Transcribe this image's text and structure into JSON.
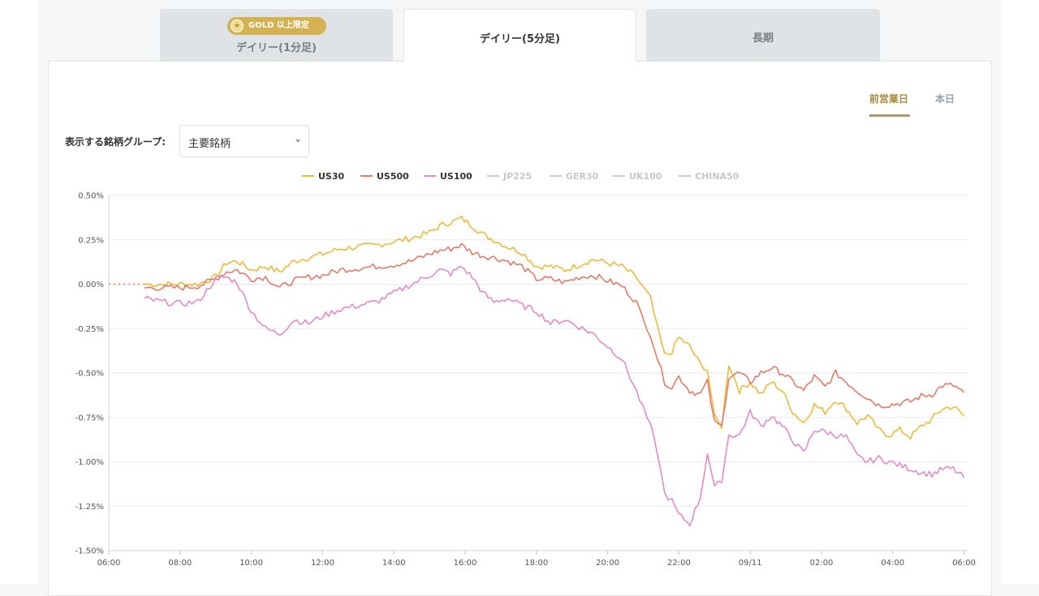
{
  "tabs": [
    {
      "label": "デイリー(1分足)",
      "badge": "GOLD 以上限定",
      "active": false
    },
    {
      "label": "デイリー(5分足)",
      "active": true
    },
    {
      "label": "長期",
      "active": false
    }
  ],
  "period_toggle": {
    "previous_day": "前営業日",
    "today": "本日",
    "selected": "前営業日"
  },
  "group_filter": {
    "label": "表示する銘柄グループ:",
    "value": "主要銘柄"
  },
  "colors": {
    "accent_gold": "#d4b251",
    "US30": "#f0b93a",
    "US500": "#e57a67",
    "US100": "#e48ac8",
    "inactive": "#c9ccd0"
  },
  "chart_data": {
    "type": "line",
    "y_unit": "%",
    "ylim": [
      -1.5,
      0.5
    ],
    "y_ticks": [
      "0.50%",
      "0.25%",
      "0.00%",
      "-0.25%",
      "-0.50%",
      "-0.75%",
      "-1.00%",
      "-1.25%",
      "-1.50%"
    ],
    "x_range_hours": [
      6,
      30.1
    ],
    "x_ticks": [
      "06:00",
      "08:00",
      "10:00",
      "12:00",
      "14:00",
      "16:00",
      "18:00",
      "20:00",
      "22:00",
      "09/11",
      "02:00",
      "04:00",
      "06:00"
    ],
    "legend_position": "top-center",
    "grid": true,
    "pre_open_dotted": {
      "x": [
        6,
        7
      ],
      "y": [
        0,
        0
      ]
    },
    "series": [
      {
        "name": "US30",
        "active": true,
        "x": [
          7,
          7.5,
          8,
          8.5,
          9,
          9.3,
          9.6,
          10,
          10.4,
          10.8,
          11.2,
          11.6,
          12,
          12.5,
          13,
          13.5,
          14,
          14.5,
          15,
          15.3,
          15.6,
          15.9,
          16.2,
          16.5,
          16.8,
          17.2,
          17.6,
          18,
          18.4,
          18.8,
          19.2,
          19.6,
          20,
          20.4,
          20.8,
          21,
          21.2,
          21.4,
          21.6,
          21.8,
          22,
          22.3,
          22.6,
          22.8,
          23,
          23.2,
          23.4,
          23.7,
          24,
          24.3,
          24.6,
          24.9,
          25.2,
          25.5,
          25.8,
          26.1,
          26.4,
          26.7,
          27,
          27.3,
          27.6,
          27.9,
          28.2,
          28.5,
          28.8,
          29.1,
          29.4,
          29.7,
          30
        ],
        "y": [
          0,
          0,
          0,
          0,
          0.04,
          0.12,
          0.13,
          0.08,
          0.1,
          0.07,
          0.13,
          0.15,
          0.17,
          0.2,
          0.21,
          0.22,
          0.24,
          0.26,
          0.29,
          0.33,
          0.35,
          0.37,
          0.33,
          0.28,
          0.25,
          0.21,
          0.18,
          0.1,
          0.1,
          0.08,
          0.11,
          0.14,
          0.12,
          0.1,
          0.04,
          -0.02,
          -0.08,
          -0.25,
          -0.4,
          -0.38,
          -0.3,
          -0.35,
          -0.45,
          -0.48,
          -0.75,
          -0.8,
          -0.45,
          -0.6,
          -0.55,
          -0.62,
          -0.55,
          -0.6,
          -0.72,
          -0.78,
          -0.68,
          -0.72,
          -0.65,
          -0.7,
          -0.78,
          -0.74,
          -0.82,
          -0.85,
          -0.82,
          -0.86,
          -0.8,
          -0.76,
          -0.7,
          -0.69,
          -0.74
        ]
      },
      {
        "name": "US500",
        "active": true,
        "x": [
          7,
          7.5,
          8,
          8.5,
          9,
          9.3,
          9.6,
          10,
          10.4,
          10.8,
          11.2,
          11.6,
          12,
          12.5,
          13,
          13.5,
          14,
          14.5,
          15,
          15.3,
          15.6,
          15.9,
          16.2,
          16.5,
          16.8,
          17.2,
          17.6,
          18,
          18.4,
          18.8,
          19.2,
          19.6,
          20,
          20.4,
          20.8,
          21,
          21.2,
          21.4,
          21.6,
          21.8,
          22,
          22.3,
          22.6,
          22.8,
          23,
          23.2,
          23.4,
          23.7,
          24,
          24.3,
          24.6,
          24.9,
          25.2,
          25.5,
          25.8,
          26.1,
          26.4,
          26.7,
          27,
          27.3,
          27.6,
          27.9,
          28.2,
          28.5,
          28.8,
          29.1,
          29.4,
          29.7,
          30
        ],
        "y": [
          -0.02,
          -0.02,
          -0.02,
          -0.01,
          0.03,
          0.07,
          0.08,
          0.03,
          0.04,
          -0.02,
          0.02,
          0.04,
          0.05,
          0.08,
          0.09,
          0.1,
          0.11,
          0.13,
          0.17,
          0.19,
          0.2,
          0.22,
          0.18,
          0.16,
          0.15,
          0.13,
          0.1,
          0.03,
          0.03,
          0.01,
          0.04,
          0.05,
          0.02,
          -0.01,
          -0.1,
          -0.2,
          -0.28,
          -0.42,
          -0.55,
          -0.58,
          -0.52,
          -0.6,
          -0.62,
          -0.55,
          -0.78,
          -0.8,
          -0.52,
          -0.5,
          -0.55,
          -0.5,
          -0.47,
          -0.5,
          -0.55,
          -0.6,
          -0.52,
          -0.58,
          -0.5,
          -0.55,
          -0.6,
          -0.64,
          -0.68,
          -0.68,
          -0.67,
          -0.66,
          -0.63,
          -0.62,
          -0.57,
          -0.57,
          -0.61
        ]
      },
      {
        "name": "US100",
        "active": true,
        "x": [
          7,
          7.5,
          8,
          8.5,
          9,
          9.3,
          9.6,
          10,
          10.4,
          10.8,
          11.2,
          11.6,
          12,
          12.5,
          13,
          13.5,
          14,
          14.5,
          15,
          15.3,
          15.6,
          15.9,
          16.2,
          16.5,
          16.8,
          17.2,
          17.6,
          18,
          18.4,
          18.8,
          19.2,
          19.6,
          20,
          20.4,
          20.8,
          21,
          21.2,
          21.4,
          21.6,
          21.8,
          22,
          22.3,
          22.6,
          22.8,
          23,
          23.2,
          23.4,
          23.7,
          24,
          24.3,
          24.6,
          24.9,
          25.2,
          25.5,
          25.8,
          26.1,
          26.4,
          26.7,
          27,
          27.3,
          27.6,
          27.9,
          28.2,
          28.5,
          28.8,
          29.1,
          29.4,
          29.7,
          30
        ],
        "y": [
          -0.08,
          -0.1,
          -0.11,
          -0.1,
          0.03,
          0.04,
          0.01,
          -0.15,
          -0.25,
          -0.28,
          -0.2,
          -0.22,
          -0.18,
          -0.14,
          -0.12,
          -0.1,
          -0.05,
          0,
          0.05,
          0.08,
          0.06,
          0.1,
          0.04,
          -0.05,
          -0.1,
          -0.08,
          -0.12,
          -0.15,
          -0.22,
          -0.2,
          -0.24,
          -0.28,
          -0.35,
          -0.42,
          -0.6,
          -0.7,
          -0.8,
          -0.95,
          -1.18,
          -1.22,
          -1.3,
          -1.35,
          -1.2,
          -0.95,
          -1.15,
          -1.1,
          -0.85,
          -0.85,
          -0.72,
          -0.8,
          -0.74,
          -0.8,
          -0.88,
          -0.95,
          -0.82,
          -0.83,
          -0.85,
          -0.86,
          -0.97,
          -1,
          -0.98,
          -1.0,
          -1.02,
          -1.04,
          -1.06,
          -1.07,
          -1.04,
          -1.04,
          -1.09
        ]
      },
      {
        "name": "JP225",
        "active": false
      },
      {
        "name": "GER30",
        "active": false
      },
      {
        "name": "UK100",
        "active": false
      },
      {
        "name": "CHINA50",
        "active": false
      }
    ]
  }
}
